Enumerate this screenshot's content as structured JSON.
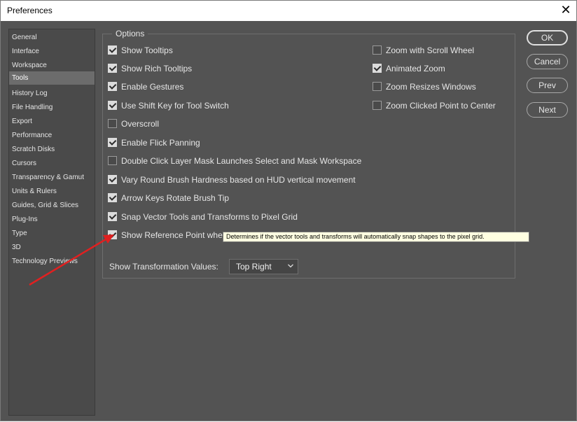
{
  "window": {
    "title": "Preferences",
    "close_glyph": "✕"
  },
  "sidebar": {
    "items": [
      {
        "label": "General"
      },
      {
        "label": "Interface"
      },
      {
        "label": "Workspace"
      },
      {
        "label": "Tools",
        "selected": true
      },
      {
        "label": "History Log"
      },
      {
        "label": "File Handling"
      },
      {
        "label": "Export"
      },
      {
        "label": "Performance"
      },
      {
        "label": "Scratch Disks"
      },
      {
        "label": "Cursors"
      },
      {
        "label": "Transparency & Gamut"
      },
      {
        "label": "Units & Rulers"
      },
      {
        "label": "Guides, Grid & Slices"
      },
      {
        "label": "Plug-Ins"
      },
      {
        "label": "Type"
      },
      {
        "label": "3D"
      },
      {
        "label": "Technology Previews"
      }
    ]
  },
  "options": {
    "legend": "Options",
    "left": [
      {
        "label": "Show Tooltips",
        "checked": true
      },
      {
        "label": "Show Rich Tooltips",
        "checked": true
      },
      {
        "label": "Enable Gestures",
        "checked": true
      },
      {
        "label": "Use Shift Key for Tool Switch",
        "checked": true
      },
      {
        "label": "Overscroll",
        "checked": false
      },
      {
        "label": "Enable Flick Panning",
        "checked": true
      },
      {
        "label": "Double Click Layer Mask Launches Select and Mask Workspace",
        "checked": false
      },
      {
        "label": "Vary Round Brush Hardness based on HUD vertical movement",
        "checked": true
      },
      {
        "label": "Arrow Keys Rotate Brush Tip",
        "checked": true
      },
      {
        "label": "Snap Vector Tools and Transforms to Pixel Grid",
        "checked": true
      },
      {
        "label": "Show Reference Point whe",
        "checked": true
      }
    ],
    "right": [
      {
        "label": "Zoom with Scroll Wheel",
        "checked": false
      },
      {
        "label": "Animated Zoom",
        "checked": true
      },
      {
        "label": "Zoom Resizes Windows",
        "checked": false
      },
      {
        "label": "Zoom Clicked Point to Center",
        "checked": false
      }
    ],
    "transformation_values_label": "Show Transformation Values:",
    "transformation_values_selected": "Top Right"
  },
  "tooltip": "Determines if the vector tools and transforms will automatically snap shapes to the pixel grid.",
  "buttons": {
    "ok": "OK",
    "cancel": "Cancel",
    "prev": "Prev",
    "next": "Next"
  },
  "colors": {
    "dialog_bg": "#535353",
    "tooltip_bg": "#ffffe1",
    "arrow": "#e02020"
  }
}
